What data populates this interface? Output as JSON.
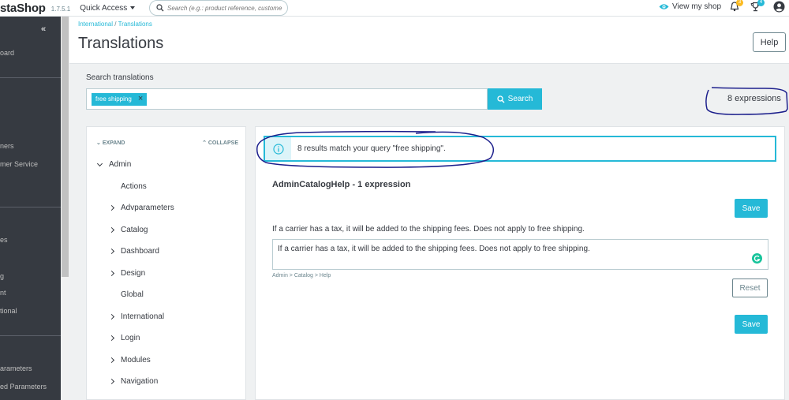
{
  "topbar": {
    "logo": "staShop",
    "version": "1.7.5.1",
    "quick_access": "Quick Access",
    "search_placeholder": "Search (e.g.: product reference, custome",
    "view_shop": "View my shop",
    "notif_badge": "3",
    "trophy_badge": "4"
  },
  "sidebar": {
    "items": [
      {
        "label": "oard"
      },
      {
        "label": "ners"
      },
      {
        "label": "mer Service"
      },
      {
        "label": "es"
      },
      {
        "label": "g"
      },
      {
        "label": "nt"
      },
      {
        "label": "tional"
      },
      {
        "label": "arameters"
      },
      {
        "label": "ed Parameters"
      }
    ]
  },
  "header": {
    "breadcrumb": [
      "International",
      "Translations"
    ],
    "title": "Translations",
    "help_label": "Help"
  },
  "search": {
    "label": "Search translations",
    "tag": "free shipping",
    "button_label": "Search",
    "expressions": "8 expressions"
  },
  "tree": {
    "expand_label": "EXPAND",
    "collapse_label": "COLLAPSE",
    "root": "Admin",
    "items": [
      {
        "label": "Actions",
        "has_children": false
      },
      {
        "label": "Advparameters",
        "has_children": true
      },
      {
        "label": "Catalog",
        "has_children": true
      },
      {
        "label": "Dashboard",
        "has_children": true
      },
      {
        "label": "Design",
        "has_children": true
      },
      {
        "label": "Global",
        "has_children": false
      },
      {
        "label": "International",
        "has_children": true
      },
      {
        "label": "Login",
        "has_children": true
      },
      {
        "label": "Modules",
        "has_children": true
      },
      {
        "label": "Navigation",
        "has_children": true
      }
    ]
  },
  "main": {
    "info_text": "8 results match your query \"free shipping\".",
    "domain_title": "AdminCatalogHelp - 1 expression",
    "save_label": "Save",
    "source_text": "If a carrier has a tax, it will be added to the shipping fees. Does not apply to free shipping.",
    "translation_value": "If a carrier has a tax, it will be added to the shipping fees. Does not apply to free shipping.",
    "path": "Admin > Catalog > Help",
    "reset_label": "Reset"
  },
  "colors": {
    "accent": "#25b9d7",
    "sidebar_bg": "#363a41",
    "annotation": "#1c1f8c"
  }
}
